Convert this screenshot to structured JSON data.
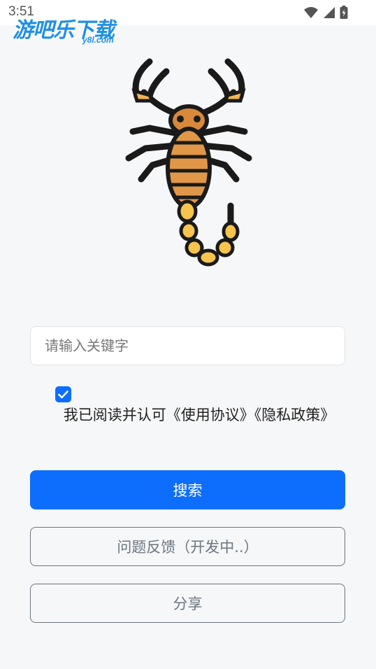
{
  "status_bar": {
    "time": "3:51"
  },
  "watermark": {
    "brand": "游吧乐下载",
    "domain": "y8l.com"
  },
  "search": {
    "placeholder": "请输入关键字",
    "value": ""
  },
  "agreement": {
    "checked": true,
    "text": "我已阅读并认可《使用协议》《隐私政策》"
  },
  "buttons": {
    "search": "搜索",
    "feedback": "问题反馈（开发中..）",
    "share": "分享"
  },
  "colors": {
    "primary": "#0d6efd",
    "outline": "#6c757d",
    "background": "#f6f7f9"
  }
}
